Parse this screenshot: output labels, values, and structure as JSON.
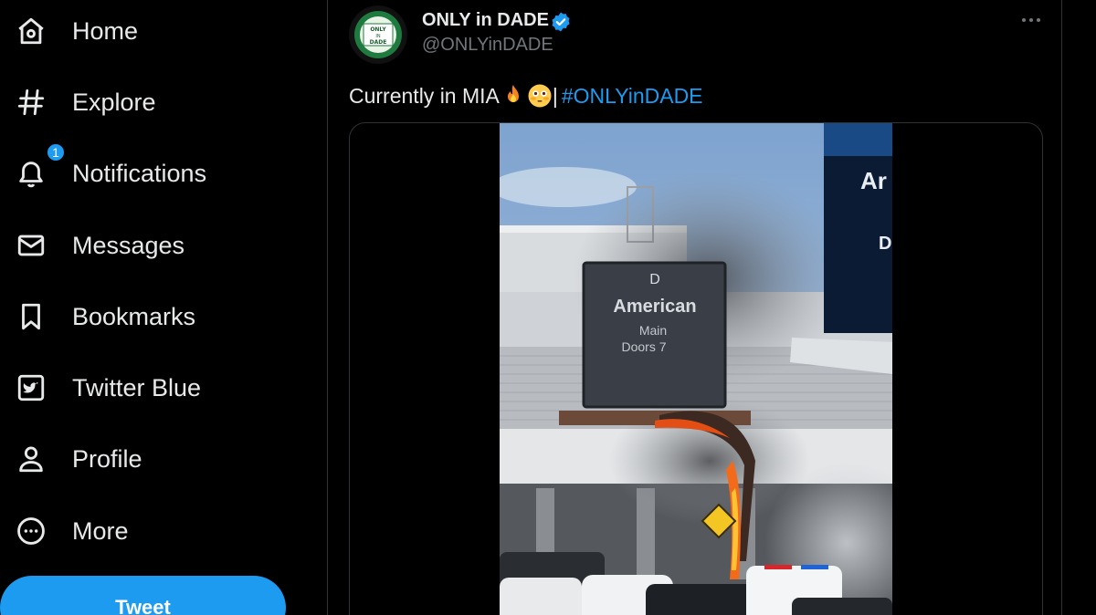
{
  "sidebar": {
    "items": [
      {
        "label": "Home",
        "icon": "home-icon"
      },
      {
        "label": "Explore",
        "icon": "hashtag-icon"
      },
      {
        "label": "Notifications",
        "icon": "bell-icon",
        "badge": "1"
      },
      {
        "label": "Messages",
        "icon": "envelope-icon"
      },
      {
        "label": "Bookmarks",
        "icon": "bookmark-icon"
      },
      {
        "label": "Twitter Blue",
        "icon": "twitter-blue-icon"
      },
      {
        "label": "Profile",
        "icon": "person-icon"
      },
      {
        "label": "More",
        "icon": "more-circle-icon"
      }
    ],
    "tweet_button": "Tweet"
  },
  "tweet": {
    "author_name": "ONLY in DADE",
    "handle": "@ONLYinDADE",
    "avatar_text": {
      "top": "ONLY",
      "middle": "IN",
      "bottom": "DADE"
    },
    "text": "Currently in MIA",
    "separator": "|",
    "hashtag": "#ONLYinDADE",
    "media": {
      "sign_letter": "D",
      "sign_title": "American",
      "sign_line1": "Main",
      "sign_line2": "Doors 7",
      "corner_sign_1": "Ar",
      "corner_sign_2": "D"
    }
  },
  "colors": {
    "accent": "#1d9bf0",
    "background": "#000000",
    "text": "#e7e9ea",
    "muted": "#71767b",
    "border": "#2f3336"
  }
}
